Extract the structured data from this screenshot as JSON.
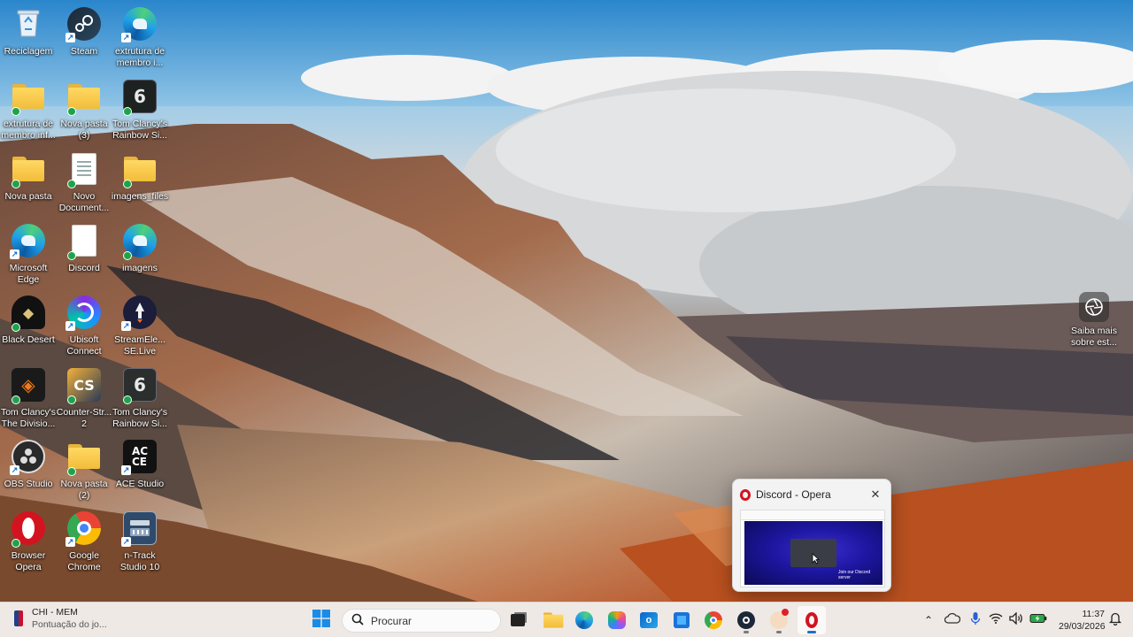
{
  "desktop": {
    "icons": [
      {
        "label": "Reciclagem",
        "icon": "recycle-bin-icon"
      },
      {
        "label": "Steam",
        "icon": "steam-icon"
      },
      {
        "label": "extrutura de membro i...",
        "icon": "edge-icon"
      },
      {
        "label": "extrutura de membro inf...",
        "icon": "folder-icon"
      },
      {
        "label": "Nova pasta (3)",
        "icon": "folder-icon"
      },
      {
        "label": "Tom Clancy's Rainbow Si...",
        "icon": "rainbow-six-icon"
      },
      {
        "label": "Nova pasta",
        "icon": "folder-icon"
      },
      {
        "label": "Novo Document...",
        "icon": "document-icon"
      },
      {
        "label": "imagens_files",
        "icon": "folder-icon"
      },
      {
        "label": "Microsoft Edge",
        "icon": "edge-icon"
      },
      {
        "label": "Discord",
        "icon": "document-icon"
      },
      {
        "label": "imagens",
        "icon": "edge-icon"
      },
      {
        "label": "Black Desert",
        "icon": "black-desert-icon"
      },
      {
        "label": "Ubisoft Connect",
        "icon": "ubisoft-icon"
      },
      {
        "label": "StreamEle... SE.Live",
        "icon": "streamelements-icon"
      },
      {
        "label": "Tom Clancy's The Divisio...",
        "icon": "division-icon"
      },
      {
        "label": "Counter-Str... 2",
        "icon": "counter-strike-icon"
      },
      {
        "label": "Tom Clancy's Rainbow Si...",
        "icon": "rainbow-six-icon"
      },
      {
        "label": "OBS Studio",
        "icon": "obs-icon"
      },
      {
        "label": "Nova pasta (2)",
        "icon": "folder-icon"
      },
      {
        "label": "ACE Studio",
        "icon": "ace-studio-icon"
      },
      {
        "label": "Browser Opera",
        "icon": "opera-icon"
      },
      {
        "label": "Google Chrome",
        "icon": "chrome-icon"
      },
      {
        "label": "n-Track Studio 10",
        "icon": "ntrack-icon"
      }
    ],
    "learn_more": {
      "label": "Saiba mais sobre est...",
      "icon": "camera-lens-icon"
    }
  },
  "preview": {
    "title": "Discord - Opera",
    "thumb_text": "Join our Discord server"
  },
  "taskbar": {
    "weather_title": "CHI - MEM",
    "weather_subtitle": "Pontuação do jo...",
    "search_placeholder": "Procurar",
    "time": "11:37",
    "date": "29/03/2026"
  }
}
